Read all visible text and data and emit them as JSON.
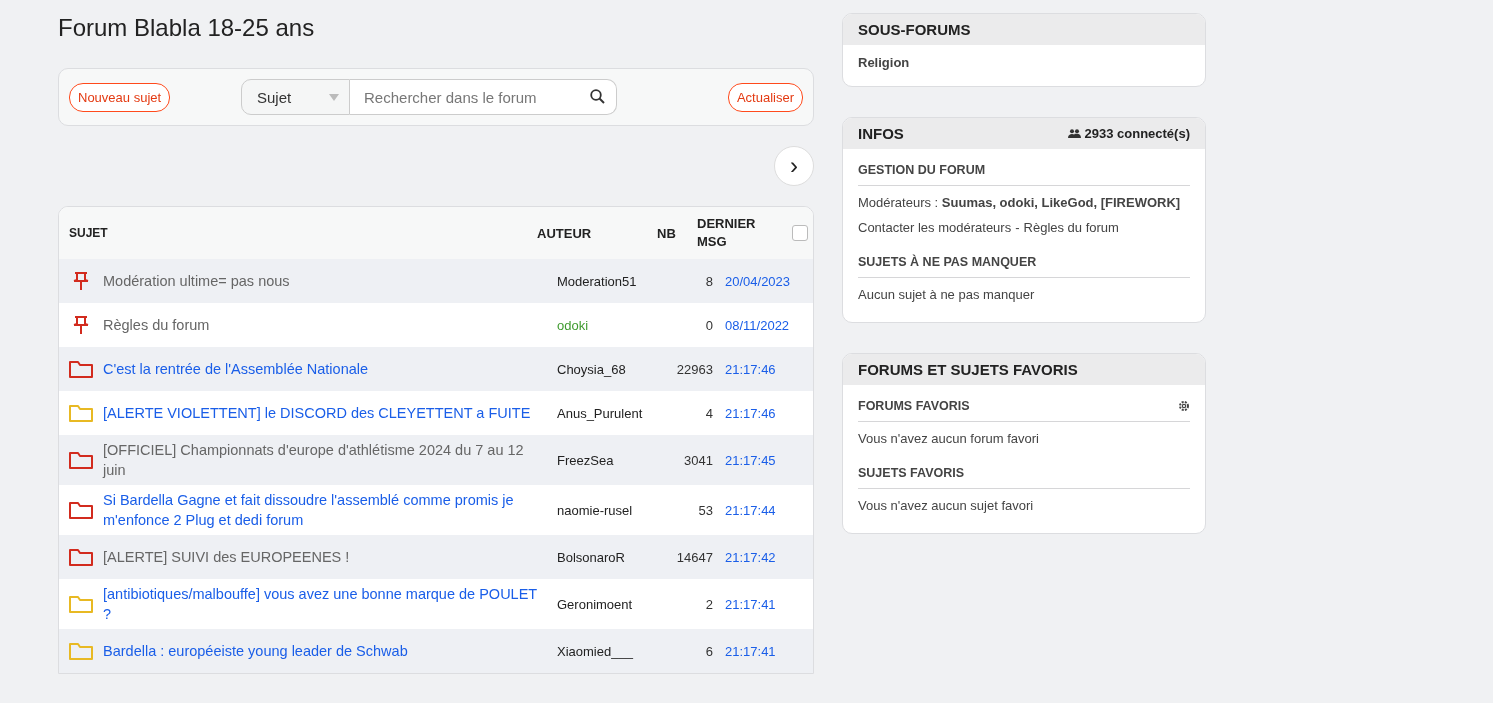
{
  "title": "Forum Blabla 18-25 ans",
  "toolbar": {
    "new_topic": "Nouveau sujet",
    "search_scope": "Sujet",
    "search": {
      "placeholder": "Rechercher dans le forum"
    },
    "refresh": "Actualiser",
    "next_page": "›"
  },
  "table": {
    "columns": [
      "SUJET",
      "AUTEUR",
      "NB",
      "DERNIER MSG"
    ],
    "select_all": {
      "checked": false
    },
    "rows": [
      {
        "kind": "pinned",
        "visited": true,
        "title": "Modération ultime= pas nous",
        "author": "Moderation51",
        "moderator": false,
        "count": "8",
        "last": "20/04/2023"
      },
      {
        "kind": "pinned",
        "visited": true,
        "title": "Règles du forum",
        "author": "odoki",
        "moderator": true,
        "count": "0",
        "last": "08/11/2022"
      },
      {
        "kind": "hot",
        "visited": false,
        "title": "C'est la rentrée de l'Assemblée Nationale",
        "author": "Choysia_68",
        "moderator": false,
        "count": "22963",
        "last": "21:17:46"
      },
      {
        "kind": "normal",
        "visited": false,
        "title": "[ALERTE VIOLETTENT] le DISCORD des CLEYETTENT a FUITE",
        "author": "Anus_Purulent",
        "moderator": false,
        "count": "4",
        "last": "21:17:46"
      },
      {
        "kind": "hot",
        "visited": true,
        "title": "[OFFICIEL] Championnats d'europe d'athlétisme 2024 du 7 au 12 juin",
        "author": "FreezSea",
        "moderator": false,
        "count": "3041",
        "last": "21:17:45"
      },
      {
        "kind": "hot",
        "visited": false,
        "title": "Si Bardella Gagne et fait dissoudre l'assemblé comme promis je m'enfonce 2 Plug et dedi forum",
        "author": "naomie-rusel",
        "moderator": false,
        "count": "53",
        "last": "21:17:44"
      },
      {
        "kind": "hot",
        "visited": true,
        "title": "[ALERTE] SUIVI des EUROPEENES !",
        "author": "BolsonaroR",
        "moderator": false,
        "count": "14647",
        "last": "21:17:42"
      },
      {
        "kind": "normal",
        "visited": false,
        "title": "[antibiotiques/malbouffe] vous avez une bonne marque de POULET ?",
        "author": "Geronimoent",
        "moderator": false,
        "count": "2",
        "last": "21:17:41"
      },
      {
        "kind": "normal",
        "visited": false,
        "title": "Bardella : européeiste young leader de Schwab",
        "author": "Xiaomied___",
        "moderator": false,
        "count": "6",
        "last": "21:17:41"
      }
    ]
  },
  "subforums": {
    "title": "SOUS-FORUMS",
    "items": [
      "Religion"
    ]
  },
  "infos": {
    "title": "INFOS",
    "online": "2933 connecté(s)",
    "management_title": "GESTION DU FORUM",
    "moderators": "Modérateurs : **Suumas, odoki, LikeGod, [FIREWORK]**",
    "contact": "Contacter les modérateurs",
    "separator": "-",
    "rules": "Règles du forum",
    "must_read_title": "SUJETS À NE PAS MANQUER",
    "must_read_empty": "Aucun sujet à ne pas manquer"
  },
  "favorites": {
    "title": "FORUMS ET SUJETS FAVORIS",
    "forums_title": "FORUMS FAVORIS",
    "forums_empty": "Vous n'avez aucun forum favori",
    "topics_title": "SUJETS FAVORIS",
    "topics_empty": "Vous n'avez aucun sujet favori"
  }
}
